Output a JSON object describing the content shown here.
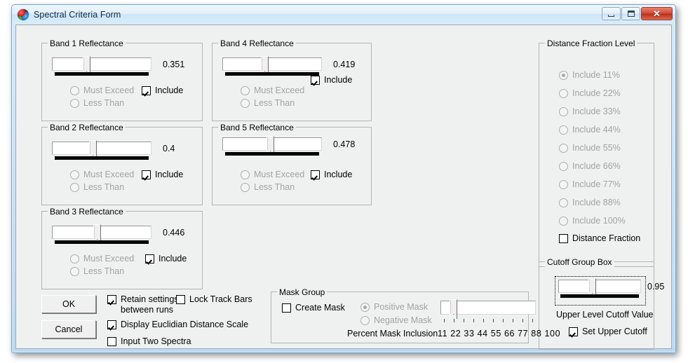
{
  "window": {
    "title": "Spectral Criteria Form",
    "icon": "sphere-icon",
    "buttons": {
      "minimize": "minimize",
      "maximize": "maximize",
      "close": "✕"
    }
  },
  "bands": [
    {
      "legend": "Band 1 Reflectance",
      "value": "0.351",
      "thumb_pct": 35,
      "must_exceed": "Must Exceed",
      "less_than": "Less Than",
      "include": "Include",
      "include_checked": true,
      "radio_selected": "none"
    },
    {
      "legend": "Band 2 Reflectance",
      "value": "0.4",
      "thumb_pct": 40,
      "must_exceed": "Must Exceed",
      "less_than": "Less Than",
      "include": "Include",
      "include_checked": true,
      "radio_selected": "none"
    },
    {
      "legend": "Band 3 Reflectance",
      "value": "0.446",
      "thumb_pct": 44.6,
      "must_exceed": "Must Exceed",
      "less_than": "Less Than",
      "include": "Include",
      "include_checked": true,
      "radio_selected": "none"
    },
    {
      "legend": "Band 4 Reflectance",
      "value": "0.419",
      "thumb_pct": 41.9,
      "must_exceed": "Must Exceed",
      "less_than": "Less Than",
      "include": "Include",
      "include_checked": true,
      "radio_selected": "none"
    },
    {
      "legend": "Band 5 Reflectance",
      "value": "0.478",
      "thumb_pct": 47.8,
      "must_exceed": "Must Exceed",
      "less_than": "Less Than",
      "include": "Include",
      "include_checked": true,
      "radio_selected": "none"
    }
  ],
  "distance_fraction": {
    "legend": "Distance Fraction Level",
    "options": [
      {
        "label": "Include 11%",
        "selected": true
      },
      {
        "label": "Include 22%",
        "selected": false
      },
      {
        "label": "Include 33%",
        "selected": false
      },
      {
        "label": "Include 44%",
        "selected": false
      },
      {
        "label": "Include 55%",
        "selected": false
      },
      {
        "label": "Include 66%",
        "selected": false
      },
      {
        "label": "Include 77%",
        "selected": false
      },
      {
        "label": "Include 88%",
        "selected": false
      },
      {
        "label": "Include 100%",
        "selected": false
      }
    ],
    "checkbox": {
      "label": "Distance Fraction",
      "checked": false
    }
  },
  "cutoff": {
    "legend": "Cutoff Group Box",
    "value": "0.95",
    "thumb_pct": 40,
    "caption": "Upper Level Cutoff Value",
    "checkbox": {
      "label": "Set Upper Cutoff",
      "checked": true
    },
    "focused": true
  },
  "mask_group": {
    "legend": "Mask Group",
    "create_mask": {
      "label": "Create Mask",
      "checked": false
    },
    "positive_mask": {
      "label": "Positive Mask",
      "selected": true
    },
    "negative_mask": {
      "label": "Negative Mask",
      "selected": false
    },
    "percent_caption": "Percent Mask Inclusion",
    "tick_labels": "11 22 33 44 55 66 77 88 100",
    "slider_thumb_pct": 11,
    "tick_count": 10
  },
  "actions": {
    "ok": "OK",
    "cancel": "Cancel",
    "retain_settings": {
      "label": "Retain settings between runs",
      "checked": true
    },
    "lock_track_bars": {
      "label": "Lock Track Bars",
      "checked": false
    },
    "display_euclidian": {
      "label": "Display Euclidian Distance Scale",
      "checked": true
    },
    "input_two_spectra": {
      "label": "Input Two Spectra",
      "checked": false
    }
  },
  "colors": {
    "face": "#eff0f0",
    "frame": "#bcd9f2",
    "close_button": "#cf4b36",
    "track_bar": "#000000",
    "disabled_text": "#a3a3a3"
  }
}
